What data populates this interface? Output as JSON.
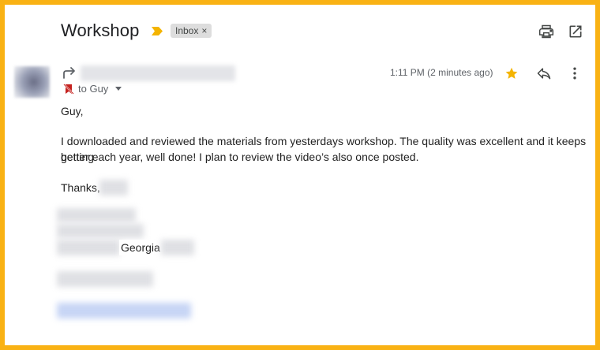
{
  "header": {
    "subject": "Workshop",
    "label": "Inbox",
    "label_remove": "×",
    "icons": [
      "print-icon",
      "open-in-new-window-icon"
    ]
  },
  "message": {
    "to_line": "to Guy",
    "time": "1:11 PM (2 minutes ago)",
    "starred": true,
    "greeting": "Guy,",
    "body_line1": "I downloaded and reviewed the materials from yesterdays workshop. The quality was excellent and it keeps getting",
    "body_line2": "better each year, well done! I plan to review the video’s also once posted.",
    "sign_off": "Thanks,",
    "signature_visible": "Georgia"
  },
  "colors": {
    "border": "#f9b214",
    "star": "#f4b400",
    "importance_marker": "#f4b400",
    "chip_bg": "#dddddd"
  }
}
